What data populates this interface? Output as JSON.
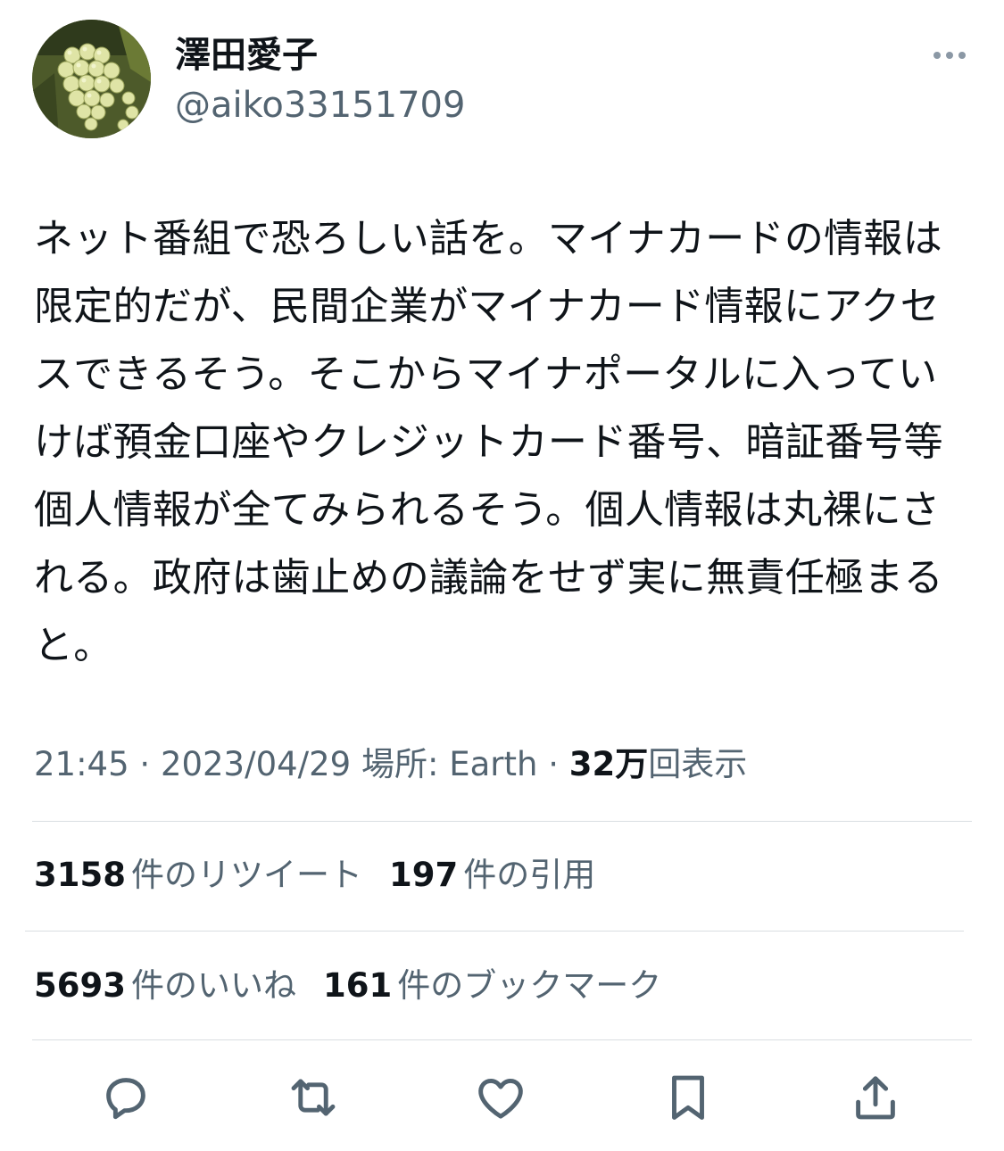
{
  "author": {
    "display_name": "澤田愛子",
    "handle": "@aiko33151709",
    "avatar_icon": "grapes-photo-avatar"
  },
  "more_icon": "more-horizontal-icon",
  "tweet": {
    "text": "ネット番組で恐ろしい話を。マイナカードの情報は限定的だが、民間企業がマイナカード情報にアクセスできるそう。そこからマイナポータルに入っていけば預金口座やクレジットカード番号、暗証番号等個人情報が全てみられるそう。個人情報は丸裸にされる。政府は歯止めの議論をせず実に無責任極まると。"
  },
  "meta": {
    "time": "21:45",
    "separator": "·",
    "date": "2023/04/29",
    "location": "場所: Earth",
    "views_count": "32万",
    "views_label": "回表示"
  },
  "stats": {
    "retweets": {
      "count": "3158",
      "label": "件のリツイート"
    },
    "quotes": {
      "count": "197",
      "label": "件の引用"
    },
    "likes": {
      "count": "5693",
      "label": "件のいいね"
    },
    "bookmarks": {
      "count": "161",
      "label": "件のブックマーク"
    }
  },
  "actions": [
    "reply-icon",
    "retweet-icon",
    "like-icon",
    "bookmark-icon",
    "share-icon"
  ],
  "colors": {
    "text": "#0f1419",
    "secondary": "#536471",
    "divider": "#d9dee2",
    "icon": "#536471"
  }
}
